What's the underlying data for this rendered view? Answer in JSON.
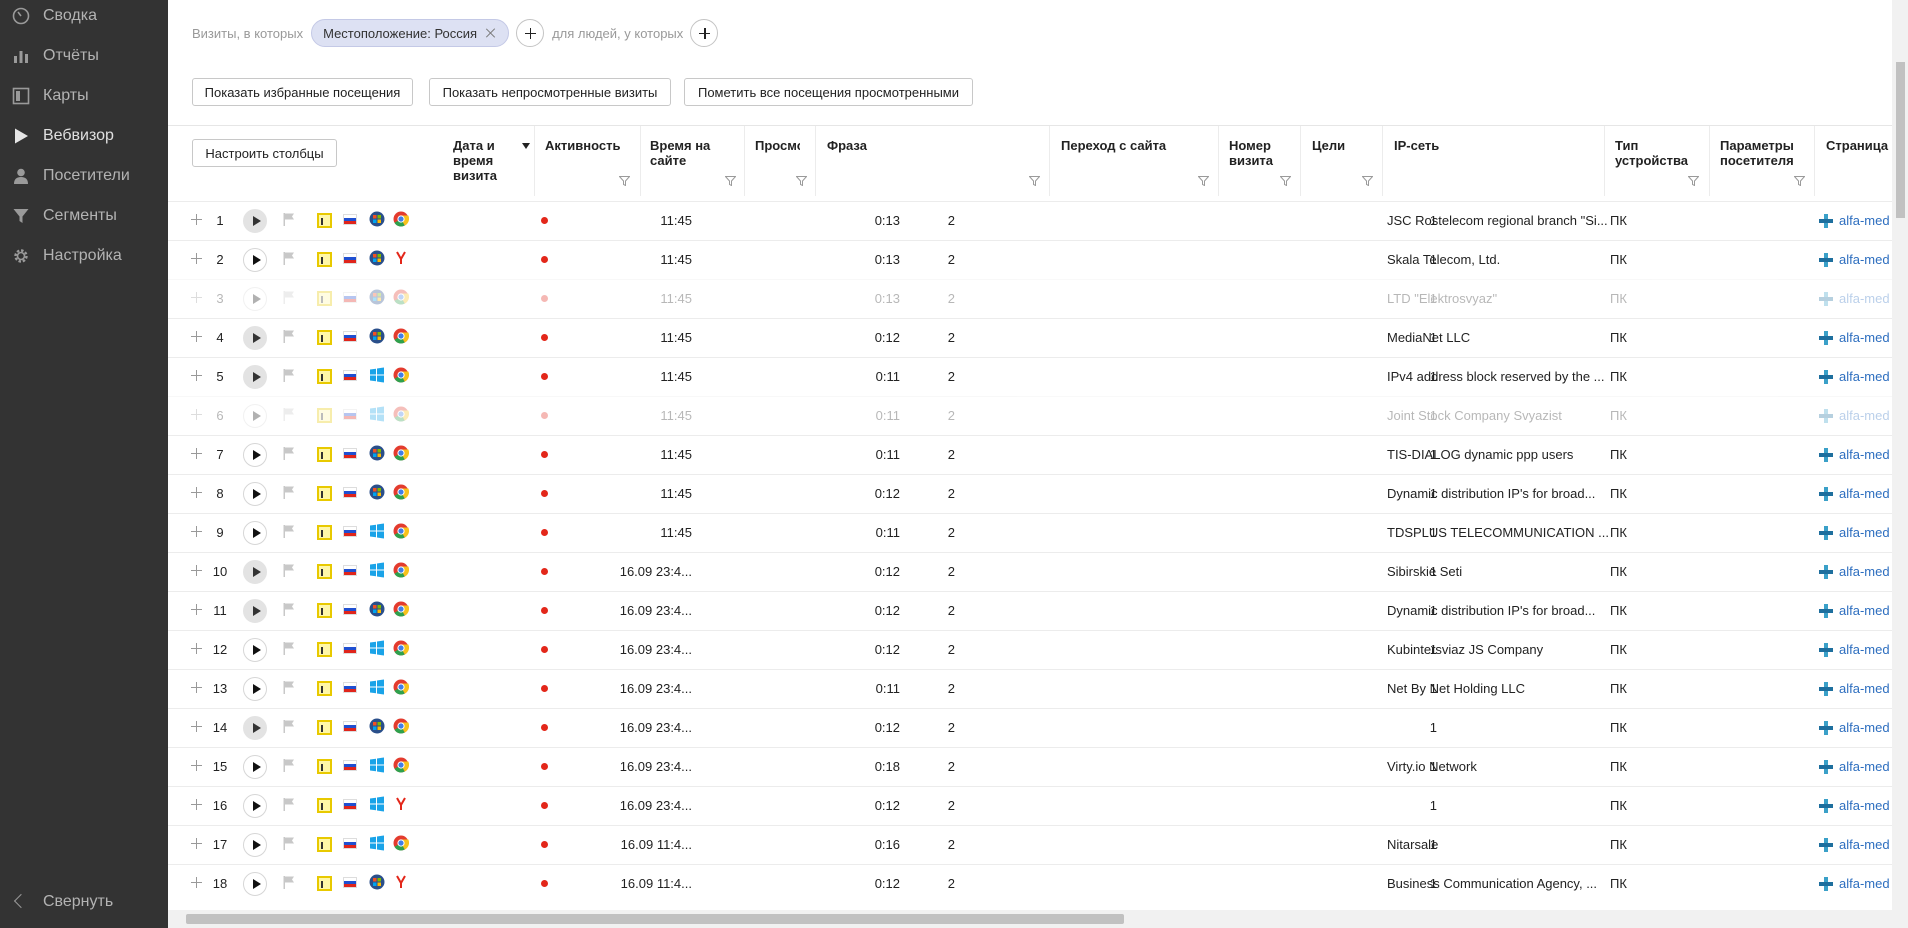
{
  "sidebar": {
    "items": [
      {
        "label": "Сводка",
        "icon": "gauge-icon"
      },
      {
        "label": "Отчёты",
        "icon": "bar-chart-icon"
      },
      {
        "label": "Карты",
        "icon": "map-icon"
      },
      {
        "label": "Вебвизор",
        "icon": "play-icon"
      },
      {
        "label": "Посетители",
        "icon": "person-icon"
      },
      {
        "label": "Сегменты",
        "icon": "funnel-icon"
      },
      {
        "label": "Настройка",
        "icon": "gear-icon"
      }
    ],
    "collapse_label": "Свернуть"
  },
  "filters": {
    "visits_label": "Визиты, в которых",
    "chip_label": "Местоположение: Россия",
    "people_label": "для людей, у которых"
  },
  "buttons": {
    "favorites": "Показать избранные посещения",
    "unviewed": "Показать непросмотренные визиты",
    "mark_all": "Пометить все посещения просмотренными",
    "configure": "Настроить столбцы"
  },
  "columns": {
    "datetime": "Дата и время визита",
    "activity": "Активность",
    "duration": "Время на сайте",
    "views": "Просмо",
    "phrase": "Фраза",
    "referrer": "Переход с сайта",
    "visit_number": "Номер визита",
    "goals": "Цели",
    "ip_network": "IP-сеть",
    "device": "Тип устройства",
    "visitor_params": "Параметры посетителя",
    "page": "Страница в"
  },
  "rows": [
    {
      "n": "1",
      "time": "11:45",
      "dur": "0:13",
      "views": "2",
      "vnum": "1",
      "ip": "JSC Rostelecom regional branch \"Si...",
      "dev": "ПК",
      "page": "alfa-med",
      "os": "win7",
      "browser": "chrome",
      "played": true,
      "dim": false
    },
    {
      "n": "2",
      "time": "11:45",
      "dur": "0:13",
      "views": "2",
      "vnum": "1",
      "ip": "Skala Telecom, Ltd.",
      "dev": "ПК",
      "page": "alfa-med",
      "os": "win7",
      "browser": "yandex",
      "played": false,
      "dim": false
    },
    {
      "n": "3",
      "time": "11:45",
      "dur": "0:13",
      "views": "2",
      "vnum": "1",
      "ip": "LTD \"Elektrosvyaz\"",
      "dev": "ПК",
      "page": "alfa-med",
      "os": "win7",
      "browser": "chrome",
      "played": false,
      "dim": true
    },
    {
      "n": "4",
      "time": "11:45",
      "dur": "0:12",
      "views": "2",
      "vnum": "1",
      "ip": "MediaNet LLC",
      "dev": "ПК",
      "page": "alfa-med",
      "os": "win7",
      "browser": "chrome",
      "played": true,
      "dim": false
    },
    {
      "n": "5",
      "time": "11:45",
      "dur": "0:11",
      "views": "2",
      "vnum": "1",
      "ip": "IPv4 address block reserved by the ...",
      "dev": "ПК",
      "page": "alfa-med",
      "os": "win10",
      "browser": "chrome",
      "played": true,
      "dim": false
    },
    {
      "n": "6",
      "time": "11:45",
      "dur": "0:11",
      "views": "2",
      "vnum": "1",
      "ip": "Joint Stock Company Svyazist",
      "dev": "ПК",
      "page": "alfa-med",
      "os": "win10",
      "browser": "chrome",
      "played": false,
      "dim": true
    },
    {
      "n": "7",
      "time": "11:45",
      "dur": "0:11",
      "views": "2",
      "vnum": "1",
      "ip": "TIS-DIALOG dynamic ppp users",
      "dev": "ПК",
      "page": "alfa-med",
      "os": "win7",
      "browser": "chrome",
      "played": false,
      "dim": false
    },
    {
      "n": "8",
      "time": "11:45",
      "dur": "0:12",
      "views": "2",
      "vnum": "1",
      "ip": "Dynamic distribution IP's for broad...",
      "dev": "ПК",
      "page": "alfa-med",
      "os": "win7",
      "browser": "chrome",
      "played": false,
      "dim": false
    },
    {
      "n": "9",
      "time": "11:45",
      "dur": "0:11",
      "views": "2",
      "vnum": "1",
      "ip": "TDSPLUS TELECOMMUNICATION ...",
      "dev": "ПК",
      "page": "alfa-med",
      "os": "win10",
      "browser": "chrome",
      "played": false,
      "dim": false
    },
    {
      "n": "10",
      "time": "16.09 23:4...",
      "dur": "0:12",
      "views": "2",
      "vnum": "1",
      "ip": "Sibirskie Seti",
      "dev": "ПК",
      "page": "alfa-med",
      "os": "win10",
      "browser": "chrome",
      "played": true,
      "dim": false
    },
    {
      "n": "11",
      "time": "16.09 23:4...",
      "dur": "0:12",
      "views": "2",
      "vnum": "1",
      "ip": "Dynamic distribution IP's for broad...",
      "dev": "ПК",
      "page": "alfa-med",
      "os": "win7",
      "browser": "chrome",
      "played": true,
      "dim": false
    },
    {
      "n": "12",
      "time": "16.09 23:4...",
      "dur": "0:12",
      "views": "2",
      "vnum": "1",
      "ip": "Kubintersviaz JS Company",
      "dev": "ПК",
      "page": "alfa-med",
      "os": "win10",
      "browser": "chrome",
      "played": false,
      "dim": false
    },
    {
      "n": "13",
      "time": "16.09 23:4...",
      "dur": "0:11",
      "views": "2",
      "vnum": "1",
      "ip": "Net By Net Holding LLC",
      "dev": "ПК",
      "page": "alfa-med",
      "os": "win10",
      "browser": "chrome",
      "played": false,
      "dim": false
    },
    {
      "n": "14",
      "time": "16.09 23:4...",
      "dur": "0:12",
      "views": "2",
      "vnum": "1",
      "ip": "",
      "dev": "ПК",
      "page": "alfa-med",
      "os": "win7",
      "browser": "chrome",
      "played": true,
      "dim": false
    },
    {
      "n": "15",
      "time": "16.09 23:4...",
      "dur": "0:18",
      "views": "2",
      "vnum": "1",
      "ip": "Virty.io Network",
      "dev": "ПК",
      "page": "alfa-med",
      "os": "win10",
      "browser": "chrome",
      "played": false,
      "dim": false
    },
    {
      "n": "16",
      "time": "16.09 23:4...",
      "dur": "0:12",
      "views": "2",
      "vnum": "1",
      "ip": "",
      "dev": "ПК",
      "page": "alfa-med",
      "os": "win10",
      "browser": "yandex",
      "played": false,
      "dim": false
    },
    {
      "n": "17",
      "time": "16.09 11:4...",
      "dur": "0:16",
      "views": "2",
      "vnum": "1",
      "ip": "Nitarsale",
      "dev": "ПК",
      "page": "alfa-med",
      "os": "win10",
      "browser": "chrome",
      "played": false,
      "dim": false
    },
    {
      "n": "18",
      "time": "16.09 11:4...",
      "dur": "0:12",
      "views": "2",
      "vnum": "1",
      "ip": "Business Communication Agency, ...",
      "dev": "ПК",
      "page": "alfa-med",
      "os": "win7",
      "browser": "yandex",
      "played": false,
      "dim": false
    }
  ],
  "colors": {
    "sidebar_bg": "#333333",
    "chip_bg": "#dde1f3",
    "activity_dot": "#e3271a",
    "link": "#2d6ebf"
  }
}
